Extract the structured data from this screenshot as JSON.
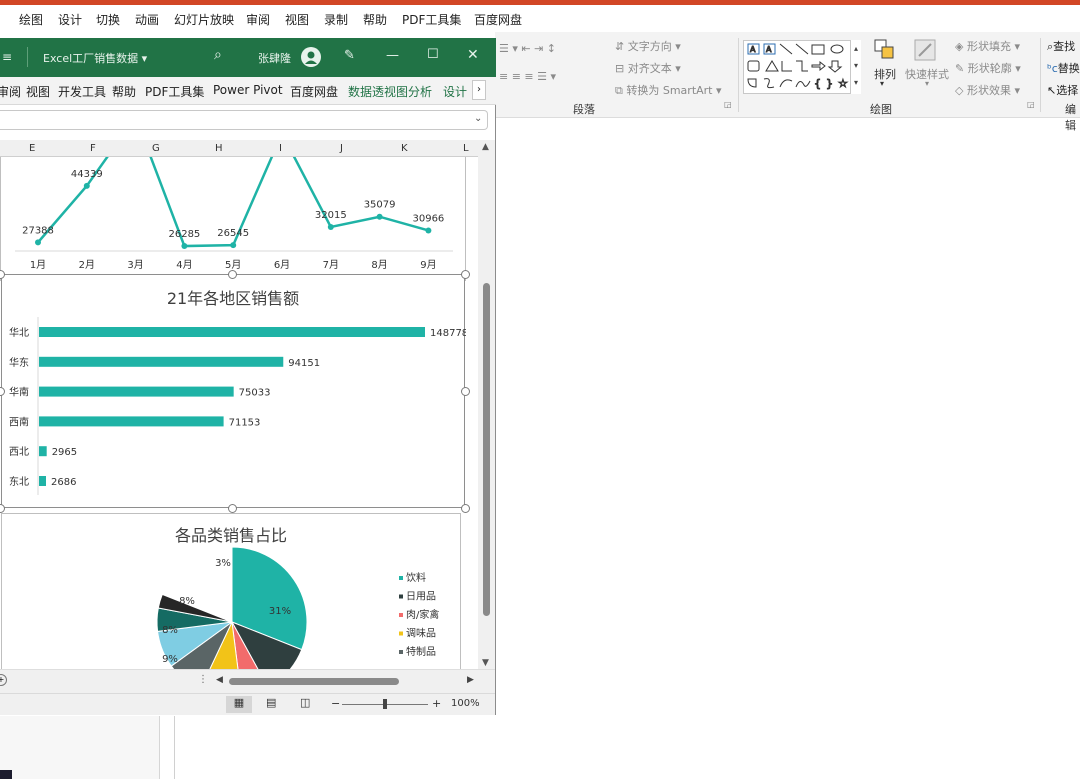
{
  "ppt_menu": [
    "绘图",
    "设计",
    "切换",
    "动画",
    "幻灯片放映",
    "审阅",
    "视图",
    "录制",
    "帮助",
    "PDF工具集",
    "百度网盘"
  ],
  "ppt_ribbon": {
    "paragraph_group": "段落",
    "drawing_group": "绘图",
    "text_direction": "文字方向",
    "align_text": "对齐文本",
    "convert_smartart": "转换为 SmartArt",
    "arrange": "排列",
    "quick_styles": "快速样式",
    "shape_fill": "形状填充",
    "shape_outline": "形状轮廓",
    "shape_effects": "形状效果",
    "find": "查找",
    "replace": "替换",
    "select": "选择",
    "edit_group": "编辑"
  },
  "excel": {
    "title": "Excel工厂销售数据",
    "user": "张肆隆",
    "tabs": [
      "审阅",
      "视图",
      "开发工具",
      "帮助",
      "PDF工具集",
      "Power Pivot",
      "百度网盘",
      "数据透视图分析",
      "设计"
    ],
    "columns": [
      "E",
      "F",
      "G",
      "H",
      "I",
      "J",
      "K",
      "L"
    ],
    "zoom": "100%"
  },
  "chart_data": [
    {
      "type": "line",
      "title": "",
      "categories": [
        "1月",
        "2月",
        "3月",
        "4月",
        "5月",
        "6月",
        "7月",
        "8月",
        "9月"
      ],
      "values": [
        27388,
        44339,
        null,
        26285,
        26545,
        null,
        32015,
        35079,
        30966
      ],
      "data_labels": [
        "27388",
        "44339",
        "",
        "26285",
        "26545",
        "",
        "32015",
        "35079",
        "30966"
      ],
      "color": "#1fb3a6"
    },
    {
      "type": "bar",
      "title": "21年各地区销售额",
      "categories": [
        "华北",
        "华东",
        "华南",
        "西南",
        "西北",
        "东北"
      ],
      "values": [
        148778,
        94151,
        75033,
        71153,
        2965,
        2686
      ],
      "data_labels": [
        "148778",
        "94151",
        "75033",
        "71153",
        "2965",
        "2686"
      ],
      "color": "#1fb3a6"
    },
    {
      "type": "pie",
      "title": "各品类销售占比",
      "legend": [
        "饮料",
        "日用品",
        "肉/家禽",
        "调味品",
        "特制品"
      ],
      "visible_slice_labels": [
        "31%",
        "9%",
        "8%",
        "8%",
        "3%"
      ],
      "colors": [
        "#1fb3a6",
        "#2f3f3f",
        "#f26b6b",
        "#f2c318",
        "#5a6566",
        "#7fcde3",
        "#156b63",
        "#262626"
      ],
      "legend_placement": "right"
    }
  ]
}
